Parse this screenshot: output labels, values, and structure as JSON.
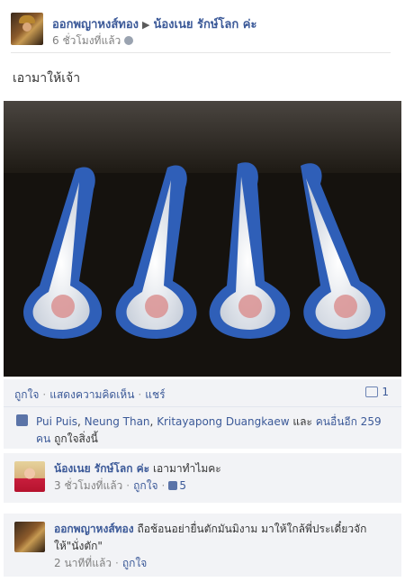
{
  "post": {
    "author": "ออกพญาหงส์ทอง",
    "target": "น้องเนย รักษ์โลก ค่ะ",
    "time": "6 ชั่วโมงที่แล้ว",
    "caption": "เอามาให้เจ้า"
  },
  "actions": {
    "like": "ถูกใจ",
    "comment": "แสดงความคิดเห็น",
    "share": "แชร์",
    "comment_count": "1"
  },
  "likes": {
    "name1": "Pui Puis",
    "name2": "Neung Than",
    "name3": "Kritayapong Duangkaew",
    "and": "และ",
    "others": "คนอื่นอีก 259 คน",
    "suffix": "ถูกใจสิ่งนี้"
  },
  "comments": [
    {
      "name": "น้องเนย รักษ์โลก ค่ะ",
      "text": "เอามาทำไมคะ",
      "time": "3 ชั่วโมงที่แล้ว",
      "like": "ถูกใจ",
      "like_count": "5"
    },
    {
      "name": "ออกพญาหงส์ทอง",
      "text": "ถือช้อนอย่ายื่นตักมันมิงาม มาให้ใกล้พี่ประเดี๋ยวจักให้\"นั่งตัก\"",
      "time": "2 นาทีที่แล้ว",
      "like": "ถูกใจ"
    }
  ],
  "icons": [
    "globe-icon",
    "comment-icon",
    "thumbs-up-icon"
  ],
  "colors": {
    "link": "#3b5998",
    "panel": "#f2f3f6",
    "meta": "#808080"
  }
}
